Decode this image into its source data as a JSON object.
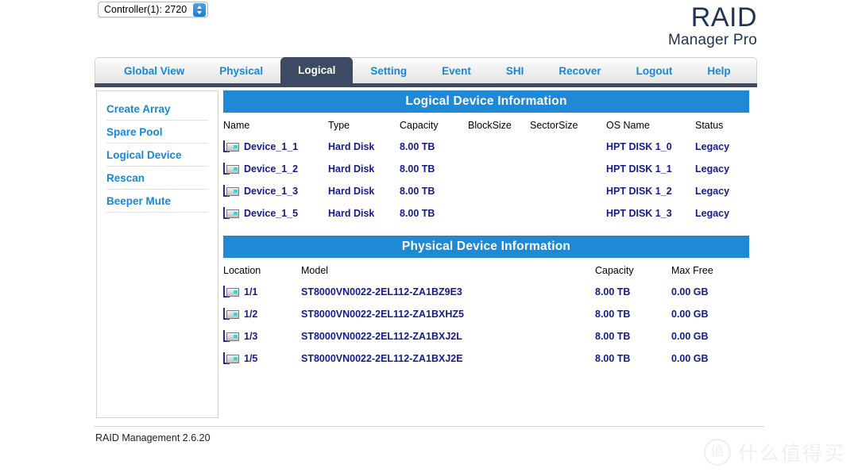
{
  "topbar": {
    "controller_select": {
      "value": "Controller(1): 2720",
      "stepper_icon": "stepper-updown-icon"
    },
    "logo": {
      "main": "RAID",
      "sub": "Manager Pro"
    }
  },
  "tabs": [
    {
      "label": "Global View",
      "active": false
    },
    {
      "label": "Physical",
      "active": false
    },
    {
      "label": "Logical",
      "active": true
    },
    {
      "label": "Setting",
      "active": false
    },
    {
      "label": "Event",
      "active": false
    },
    {
      "label": "SHI",
      "active": false
    },
    {
      "label": "Recover",
      "active": false
    },
    {
      "label": "Logout",
      "active": false
    },
    {
      "label": "Help",
      "active": false
    }
  ],
  "sidebar": {
    "items": [
      {
        "label": "Create Array"
      },
      {
        "label": "Spare Pool"
      },
      {
        "label": "Logical Device"
      },
      {
        "label": "Rescan"
      },
      {
        "label": "Beeper Mute"
      }
    ]
  },
  "logical_panel": {
    "title": "Logical Device Information",
    "columns": [
      "Name",
      "Type",
      "Capacity",
      "BlockSize",
      "SectorSize",
      "OS Name",
      "Status"
    ],
    "rows": [
      {
        "name": "Device_1_1",
        "type": "Hard Disk",
        "capacity": "8.00 TB",
        "blocksize": "",
        "sectorsize": "",
        "osname": "HPT DISK 1_0",
        "status": "Legacy",
        "icon": "disk-icon"
      },
      {
        "name": "Device_1_2",
        "type": "Hard Disk",
        "capacity": "8.00 TB",
        "blocksize": "",
        "sectorsize": "",
        "osname": "HPT DISK 1_1",
        "status": "Legacy",
        "icon": "disk-icon"
      },
      {
        "name": "Device_1_3",
        "type": "Hard Disk",
        "capacity": "8.00 TB",
        "blocksize": "",
        "sectorsize": "",
        "osname": "HPT DISK 1_2",
        "status": "Legacy",
        "icon": "disk-icon"
      },
      {
        "name": "Device_1_5",
        "type": "Hard Disk",
        "capacity": "8.00 TB",
        "blocksize": "",
        "sectorsize": "",
        "osname": "HPT DISK 1_3",
        "status": "Legacy",
        "icon": "disk-icon"
      }
    ]
  },
  "physical_panel": {
    "title": "Physical Device Information",
    "columns": [
      "Location",
      "Model",
      "Capacity",
      "Max Free"
    ],
    "rows": [
      {
        "location": "1/1",
        "model": "ST8000VN0022-2EL112-ZA1BZ9E3",
        "capacity": "8.00 TB",
        "maxfree": "0.00 GB",
        "icon": "disk-icon"
      },
      {
        "location": "1/2",
        "model": "ST8000VN0022-2EL112-ZA1BXHZ5",
        "capacity": "8.00 TB",
        "maxfree": "0.00 GB",
        "icon": "disk-icon"
      },
      {
        "location": "1/3",
        "model": "ST8000VN0022-2EL112-ZA1BXJ2L",
        "capacity": "8.00 TB",
        "maxfree": "0.00 GB",
        "icon": "disk-icon"
      },
      {
        "location": "1/5",
        "model": "ST8000VN0022-2EL112-ZA1BXJ2E",
        "capacity": "8.00 TB",
        "maxfree": "0.00 GB",
        "icon": "disk-icon"
      }
    ]
  },
  "footer": {
    "text": "RAID Management 2.6.20"
  },
  "watermark": {
    "badge": "值",
    "text": "什么值得买"
  },
  "colors": {
    "accent_blue": "#2089d6",
    "link_blue": "#1787d8",
    "active_tab": "#3c4b63",
    "data_navy": "#151b8d",
    "logo_navy": "#1e3355"
  }
}
